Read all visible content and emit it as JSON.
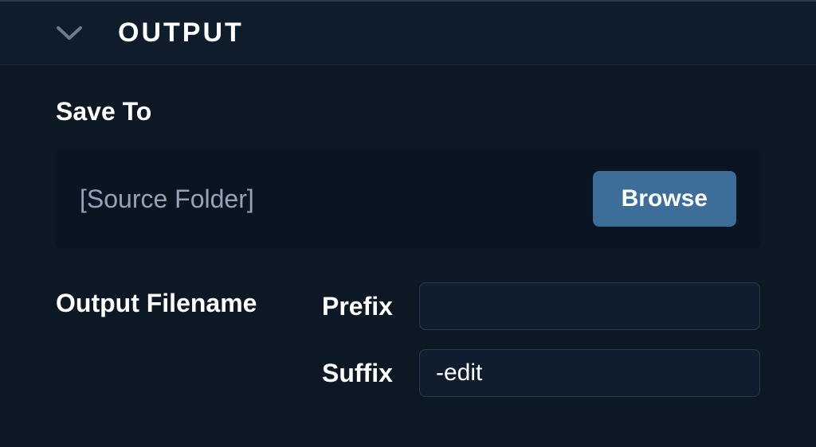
{
  "section": {
    "title": "OUTPUT"
  },
  "saveTo": {
    "label": "Save To",
    "path": "[Source Folder]",
    "browseLabel": "Browse"
  },
  "filename": {
    "label": "Output Filename",
    "prefix": {
      "label": "Prefix",
      "value": ""
    },
    "suffix": {
      "label": "Suffix",
      "value": "-edit"
    }
  }
}
